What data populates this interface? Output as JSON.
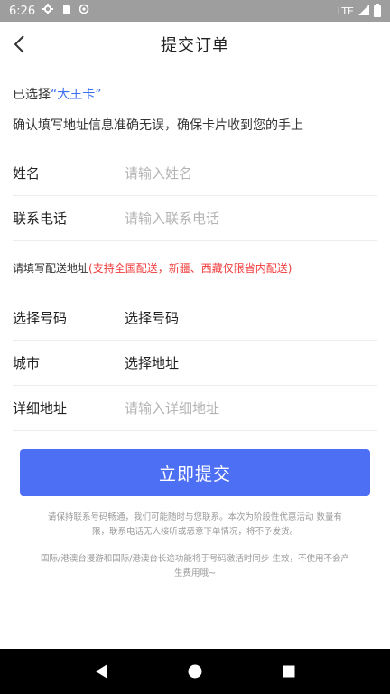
{
  "status_bar": {
    "time": "6:26",
    "network": "LTE"
  },
  "header": {
    "title": "提交订单"
  },
  "selection": {
    "prefix": "已选择",
    "card_name": "“大王卡”"
  },
  "confirm_tip": "确认填写地址信息准确无误，确保卡片收到您的手上",
  "form": {
    "name": {
      "label": "姓名",
      "placeholder": "请输入姓名"
    },
    "phone": {
      "label": "联系电话",
      "placeholder": "请输入联系电话"
    },
    "address_note": {
      "text": "请填写配送地址",
      "highlight": "(支持全国配送，新疆、西藏仅限省内配送)"
    },
    "number": {
      "label": "选择号码",
      "value": "选择号码"
    },
    "city": {
      "label": "城市",
      "value": "选择地址"
    },
    "detail": {
      "label": "详细地址",
      "placeholder": "请输入详细地址"
    }
  },
  "submit": {
    "label": "立即提交"
  },
  "footnotes": {
    "line1": "请保持联系号码畅通，我们可能随时与您联系。本次为阶段性优惠活动 数量有限，联系电话无人接听或恶意下单情况，将不予发货。",
    "line2": "国际/港澳台漫游和国际/港澳台长途功能将于号码激活时同步 生效，不使用不会产生费用哦~"
  },
  "colors": {
    "accent": "#4d6ff4",
    "card_link": "#3b6ef0",
    "warning_red": "#f03a3a"
  }
}
